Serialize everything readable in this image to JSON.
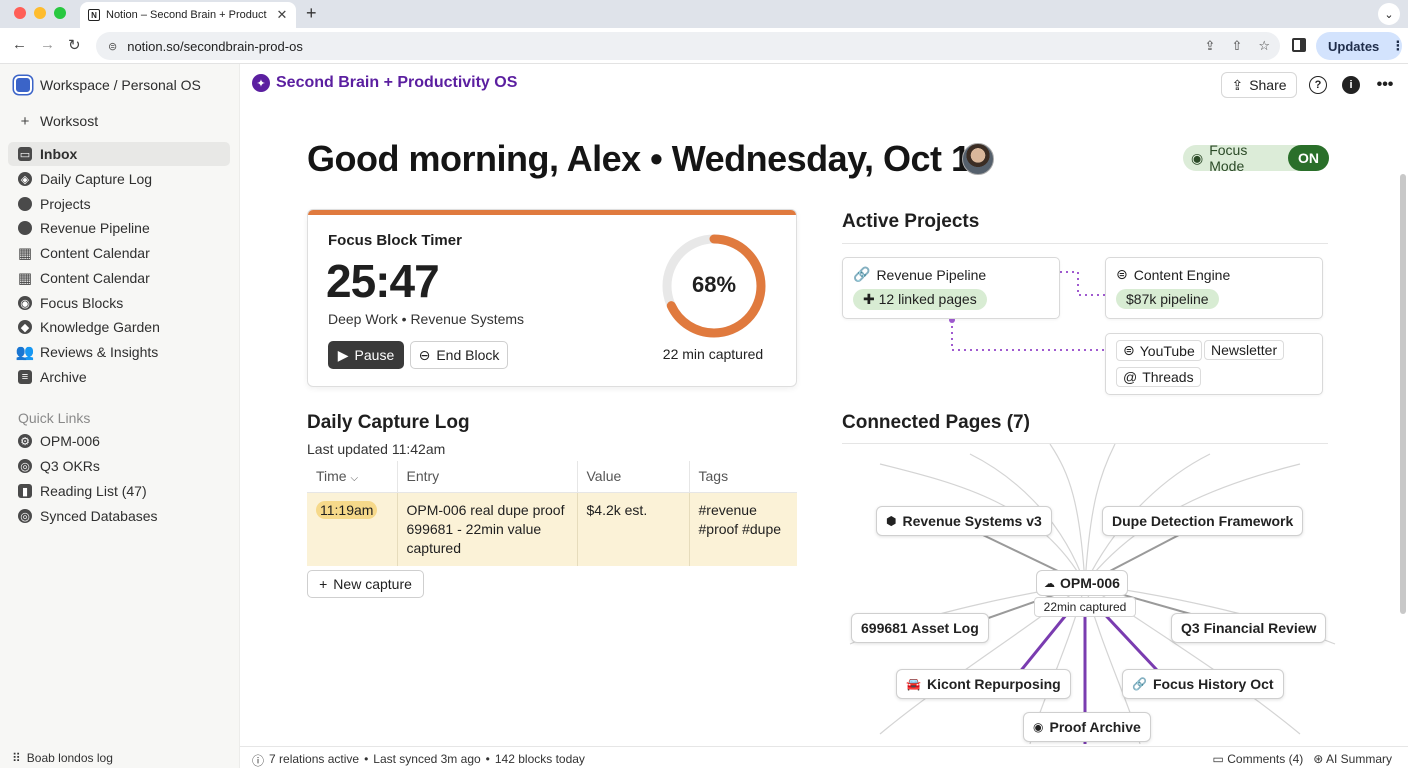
{
  "browser": {
    "tab_title": "Notion – Second Brain + Product",
    "tab_close": "✕",
    "new_tab": "+",
    "url": "notion.so/secondbrain-prod-os",
    "updates_label": "Updates"
  },
  "sidebar": {
    "workspace": "Workspace / Personal OS",
    "items": [
      {
        "label": "Worksost",
        "icon": "plus-icon"
      },
      {
        "label": "Inbox",
        "icon": "inbox-icon"
      },
      {
        "label": "Daily Capture Log",
        "icon": "compass-icon"
      },
      {
        "label": "Projects",
        "icon": "folder-icon"
      },
      {
        "label": "Revenue Pipeline",
        "icon": "pipeline-icon"
      },
      {
        "label": "Content Calendar",
        "icon": "calendar-icon"
      },
      {
        "label": "Content Calendar",
        "icon": "calendar-icon"
      },
      {
        "label": "Focus Blocks",
        "icon": "target-icon"
      },
      {
        "label": "Knowledge Garden",
        "icon": "tag-icon"
      },
      {
        "label": "Reviews & Insights",
        "icon": "people-icon"
      },
      {
        "label": "Archive",
        "icon": "archive-icon"
      }
    ],
    "quick_links_title": "Quick Links",
    "quick_links": [
      {
        "label": "OPM-006",
        "icon": "gear-icon"
      },
      {
        "label": "Q3 OKRs",
        "icon": "target-icon"
      },
      {
        "label": "Reading List (47)",
        "icon": "book-icon"
      },
      {
        "label": "Synced Databases",
        "icon": "sync-icon"
      }
    ],
    "footer": "Boab londos log"
  },
  "page": {
    "brand": "Second Brain + Productivity OS",
    "share": "Share",
    "greeting": "Good morning, Alex • Wednesday, Oct 16",
    "focus_mode_label": "Focus Mode",
    "focus_mode_state": "ON"
  },
  "timer": {
    "title": "Focus Block Timer",
    "time": "25:47",
    "subtitle": "Deep Work • Revenue Systems",
    "pause": "Pause",
    "end": "End Block",
    "progress_pct": 68,
    "progress_label": "68%",
    "captured": "22 min captured",
    "accent": "#e07a3e"
  },
  "capture_log": {
    "title": "Daily Capture Log",
    "updated": "Last updated 11:42am",
    "columns": [
      "Time",
      "Entry",
      "Value",
      "Tags"
    ],
    "rows": [
      {
        "time": "11:19am",
        "entry": "OPM-006 real dupe proof 699681 - 22min value captured",
        "value": "$4.2k est.",
        "tags": "#revenue #proof #dupe"
      }
    ],
    "new_capture": "New capture"
  },
  "active_projects": {
    "title": "Active Projects",
    "revenue_pipeline": {
      "name": "Revenue Pipeline",
      "chip": "12 linked pages"
    },
    "content_engine": {
      "name": "Content Engine",
      "chip": "$87k pipeline"
    },
    "channels": [
      "YouTube",
      "Newsletter",
      "Threads"
    ]
  },
  "connected_pages": {
    "title": "Connected Pages (7)",
    "center": "OPM-006",
    "center_sub": "22min captured",
    "nodes": [
      "Revenue Systems v3",
      "Dupe Detection Framework",
      "699681 Asset Log",
      "Q3 Financial Review",
      "Kicont Repurposing",
      "Focus History Oct",
      "Proof Archive"
    ]
  },
  "status": {
    "relations": "7 relations active",
    "synced": "Last synced 3m ago",
    "blocks": "142 blocks today",
    "comments": "Comments (4)",
    "ai_summary": "AI Summary"
  },
  "colors": {
    "brand": "#5b1fa0",
    "graph_link": "#7a3cb0",
    "focus_on": "#2a6f2a"
  }
}
